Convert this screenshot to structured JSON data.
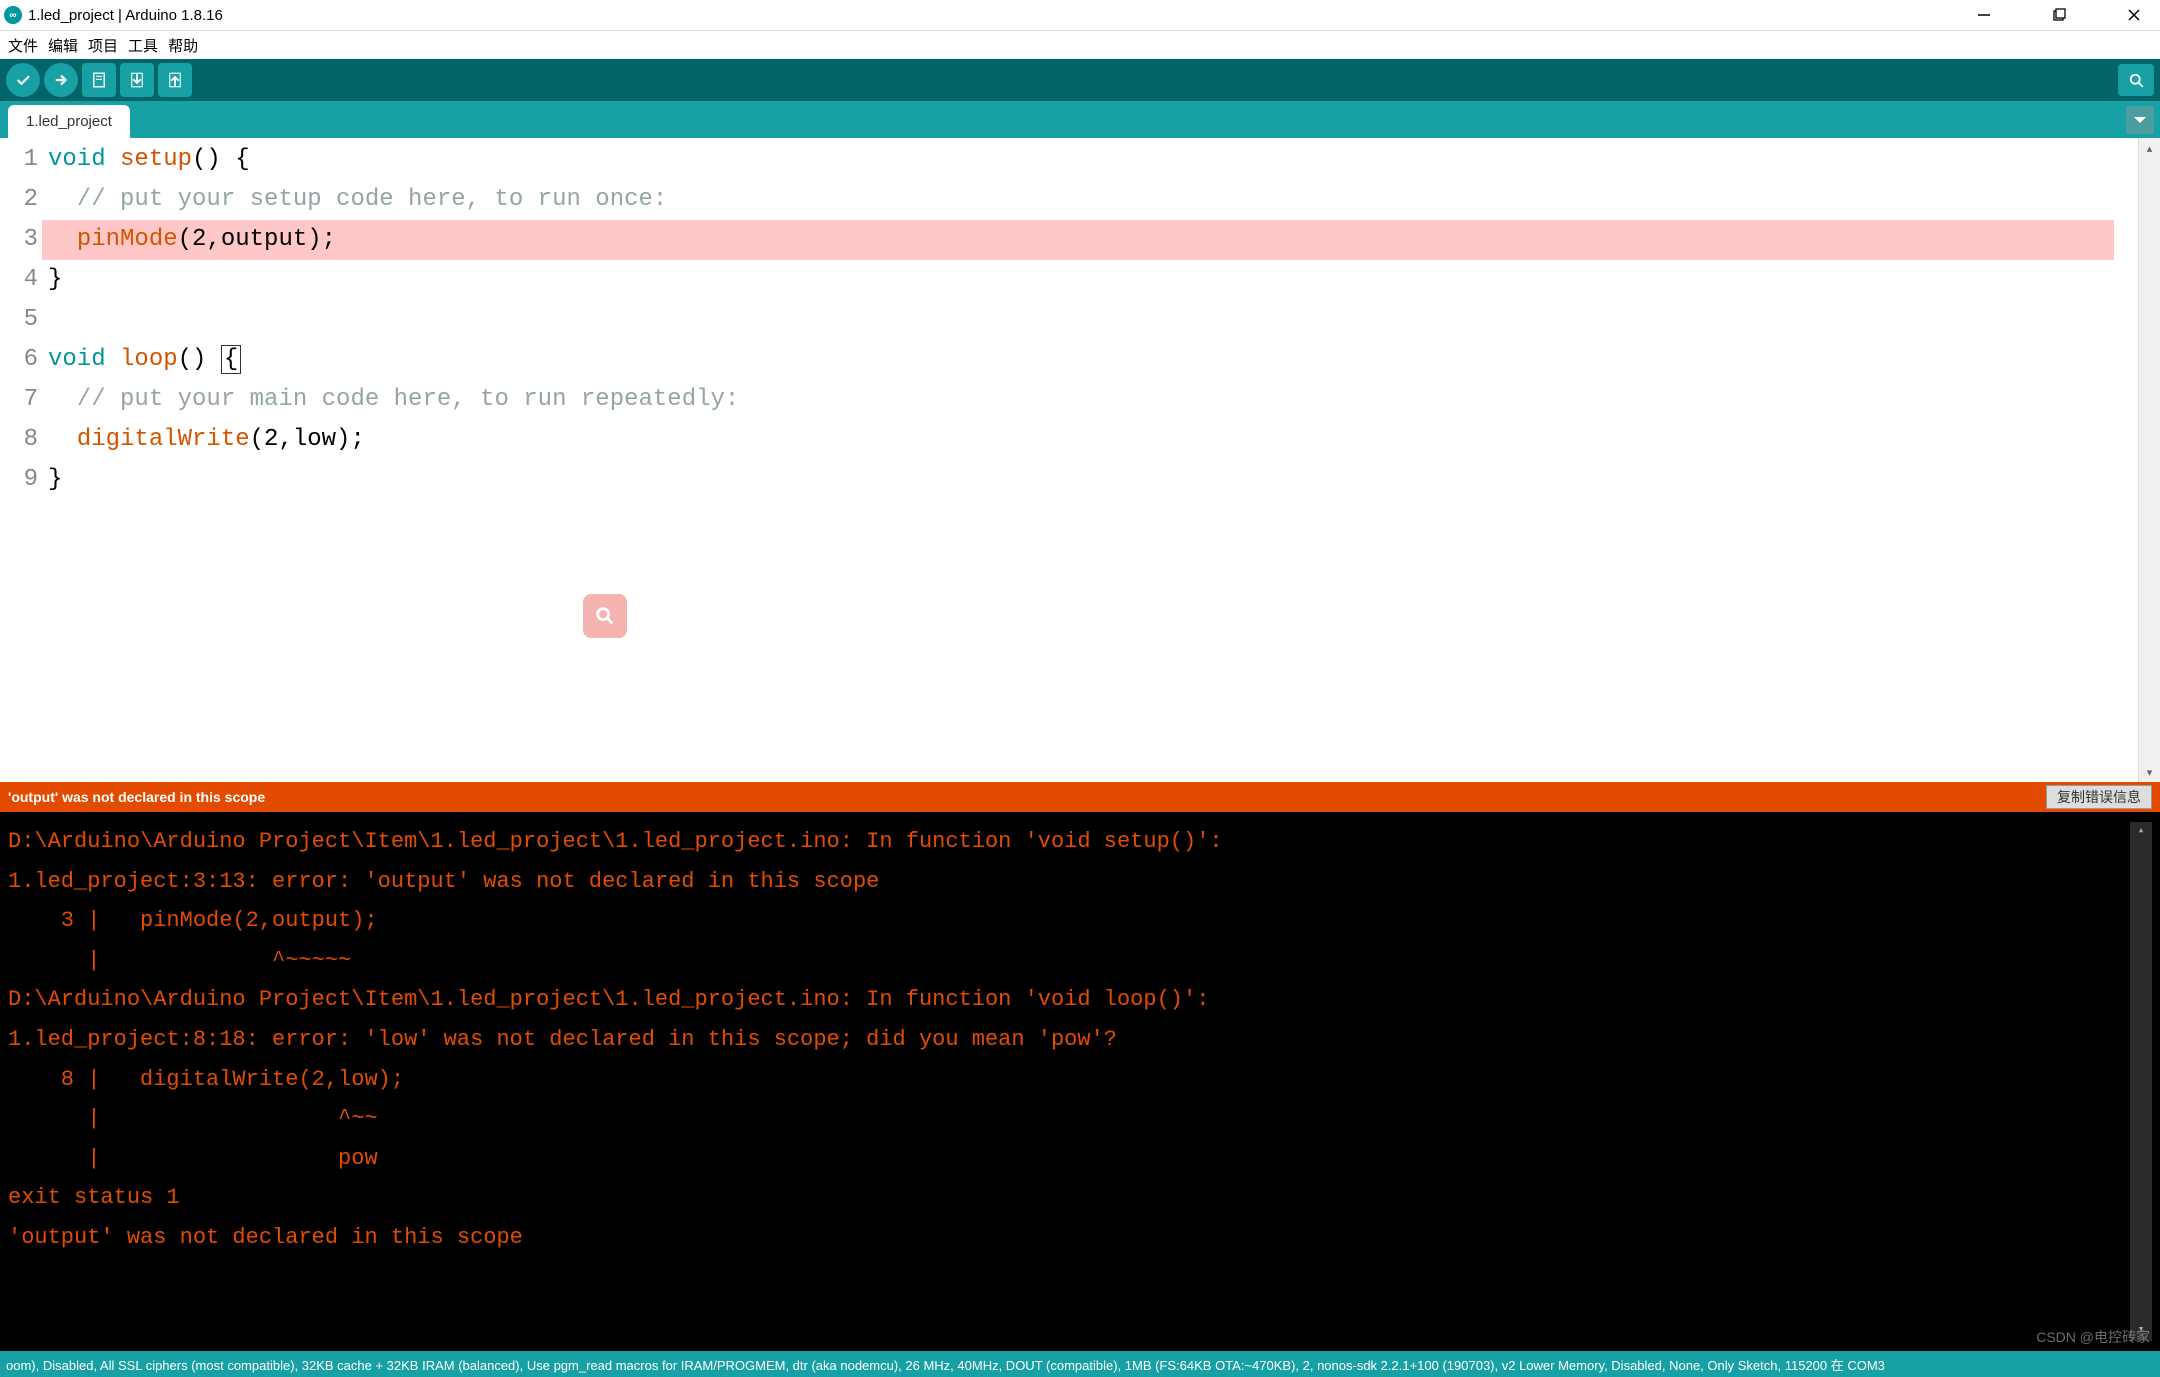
{
  "window": {
    "title": "1.led_project | Arduino 1.8.16"
  },
  "menu": {
    "file": "文件",
    "edit": "编辑",
    "project": "项目",
    "tools": "工具",
    "help": "帮助"
  },
  "tab": {
    "name": "1.led_project"
  },
  "code": {
    "lines": [
      "1",
      "2",
      "3",
      "4",
      "5",
      "6",
      "7",
      "8",
      "9"
    ],
    "l1_kw": "void",
    "l1_fn": "setup",
    "l1_rest": "() {",
    "l2": "  // put your setup code here, to run once:",
    "l3_fn": "pinMode",
    "l3_args": "(2,output);",
    "l4": "}",
    "l5": "",
    "l6_kw": "void",
    "l6_fn": "loop",
    "l6_mid": "() ",
    "l6_brace": "{",
    "l7": "  // put your main code here, to run repeatedly:",
    "l8_fn": "digitalWrite",
    "l8_args": "(2,low);",
    "l9": "}"
  },
  "error_bar": {
    "message": "'output' was not declared in this scope",
    "copy_btn": "复制错误信息"
  },
  "console": {
    "text": "D:\\Arduino\\Arduino Project\\Item\\1.led_project\\1.led_project.ino: In function 'void setup()':\n1.led_project:3:13: error: 'output' was not declared in this scope\n    3 |   pinMode(2,output);\n      |             ^~~~~~\nD:\\Arduino\\Arduino Project\\Item\\1.led_project\\1.led_project.ino: In function 'void loop()':\n1.led_project:8:18: error: 'low' was not declared in this scope; did you mean 'pow'?\n    8 |   digitalWrite(2,low);\n      |                  ^~~\n      |                  pow\nexit status 1\n'output' was not declared in this scope"
  },
  "statusbar": {
    "text": "oom), Disabled, All SSL ciphers (most compatible), 32KB cache + 32KB IRAM (balanced), Use pgm_read macros for IRAM/PROGMEM, dtr (aka nodemcu), 26 MHz, 40MHz, DOUT (compatible), 1MB (FS:64KB OTA:~470KB), 2, nonos-sdk 2.2.1+100 (190703), v2 Lower Memory, Disabled, None, Only Sketch, 115200 在 COM3"
  },
  "watermark": "CSDN @电控砖家"
}
